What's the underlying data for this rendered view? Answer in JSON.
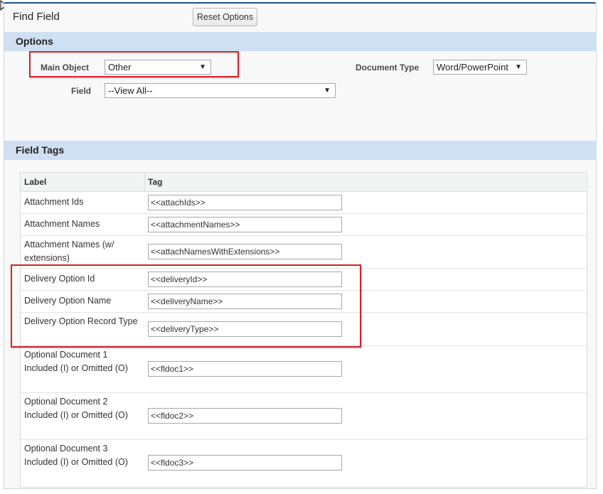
{
  "header": {
    "title": "Find Field",
    "reset_label": "Reset Options"
  },
  "options": {
    "heading": "Options",
    "main_object_label": "Main Object",
    "main_object_value": "Other",
    "document_type_label": "Document Type",
    "document_type_value": "Word/PowerPoint",
    "field_label": "Field",
    "field_value": "--View All--"
  },
  "field_tags": {
    "heading": "Field Tags",
    "columns": [
      "Label",
      "Tag"
    ],
    "rows": [
      {
        "label": "Attachment Ids",
        "tag": "<<attachIds>>"
      },
      {
        "label": "Attachment Names",
        "tag": "<<attachmentNames>>"
      },
      {
        "label": "Attachment Names (w/ extensions)",
        "tag": "<<attachNamesWithExtensions>>"
      },
      {
        "label": "Delivery Option Id",
        "tag": "<<deliveryId>>"
      },
      {
        "label": "Delivery Option Name",
        "tag": "<<deliveryName>>"
      },
      {
        "label": "Delivery Option Record Type",
        "tag": "<<deliveryType>>"
      },
      {
        "label": "Optional Document 1 Included (I) or Omitted (O)",
        "tag": "<<fldoc1>>"
      },
      {
        "label": "Optional Document 2 Included (I) or Omitted (O)",
        "tag": "<<fldoc2>>"
      },
      {
        "label": "Optional Document 3 Included (I) or Omitted (O)",
        "tag": "<<fldoc3>>"
      }
    ]
  },
  "colors": {
    "section_bar": "#cfe0f2",
    "highlight": "#d2232a",
    "panel_top": "#1b5297"
  },
  "icons": {
    "cursor": "mouse-pointer-icon",
    "dropdown": "dropdown-arrow-icon"
  }
}
